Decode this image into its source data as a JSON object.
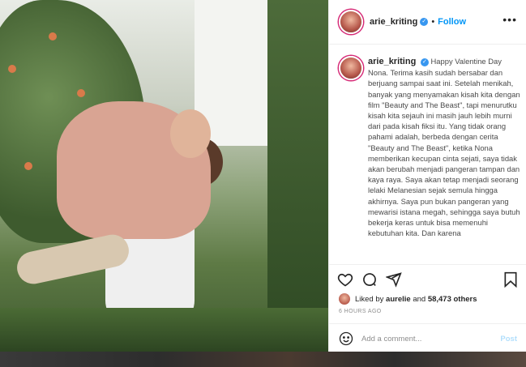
{
  "post": {
    "username": "arie_kriting",
    "separator": "•",
    "follow_label": "Follow",
    "more_label": "•••"
  },
  "caption": {
    "username": "arie_kriting",
    "text": "Happy Valentine Day Nona. Terima kasih sudah bersabar dan berjuang sampai saat ini. Setelah menikah, banyak yang menyamakan kisah kita dengan film \"Beauty and The Beast\", tapi menurutku kisah kita sejauh ini masih jauh lebih murni dari pada kisah fiksi itu. Yang tidak orang pahami adalah, berbeda dengan cerita \"Beauty and The Beast\", ketika Nona memberikan kecupan cinta sejati, saya tidak akan berubah menjadi pangeran tampan dan kaya raya. Saya akan tetap menjadi seorang lelaki Melanesian sejak semula hingga akhirnya. Saya pun bukan pangeran yang mewarisi istana megah, sehingga saya butuh bekerja keras untuk bisa memenuhi kebutuhan kita. Dan karena"
  },
  "likes": {
    "prefix": "Liked by",
    "user": "aurelie",
    "mid": "and",
    "count": "58,473 others"
  },
  "timestamp": "6 HOURS AGO",
  "comment": {
    "placeholder": "Add a comment...",
    "post_label": "Post"
  },
  "colors": {
    "link": "#0095f6",
    "verified": "#3897f0",
    "post_disabled": "#b2dffc",
    "text": "#262626",
    "muted": "#8e8e8e"
  },
  "icons": [
    "heart-icon",
    "comment-icon",
    "share-icon",
    "bookmark-icon",
    "verified-icon",
    "emoji-icon",
    "more-icon"
  ]
}
